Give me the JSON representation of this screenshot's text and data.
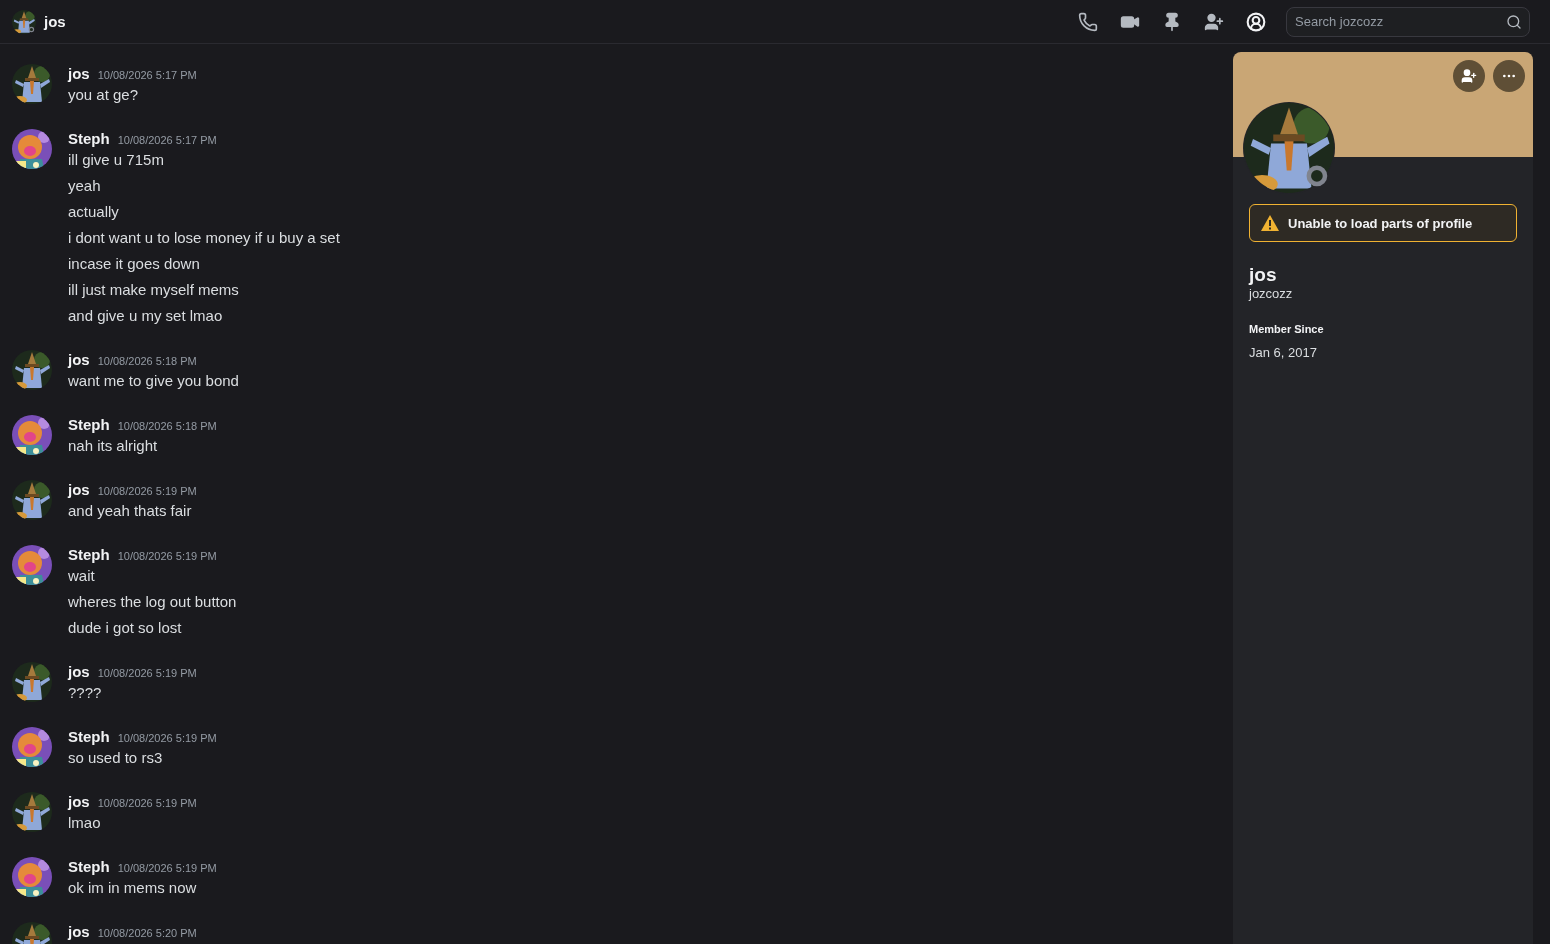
{
  "header": {
    "title": "jos",
    "kind": "wizard",
    "online": false
  },
  "toolbar": [
    {
      "kind": "call",
      "selected": false
    },
    {
      "kind": "video",
      "selected": false
    },
    {
      "kind": "pin",
      "selected": false
    },
    {
      "kind": "add-member",
      "selected": false
    },
    {
      "kind": "profile",
      "selected": true
    }
  ],
  "search": {
    "placeholder": "Search jozcozz"
  },
  "messages": [
    {
      "author": "jos",
      "kind": "wizard",
      "time": "10/08/2026 5:17 PM",
      "lines": [
        "you at ge?"
      ]
    },
    {
      "author": "Steph",
      "kind": "orange",
      "time": "10/08/2026 5:17 PM",
      "lines": [
        "ill give u 715m",
        "yeah",
        "actually",
        "i dont want u to lose money if u buy a set",
        "incase it goes down",
        "ill just make myself mems",
        "and give u my set lmao"
      ]
    },
    {
      "author": "jos",
      "kind": "wizard",
      "time": "10/08/2026 5:18 PM",
      "lines": [
        "want me to give you bond"
      ]
    },
    {
      "author": "Steph",
      "kind": "orange",
      "time": "10/08/2026 5:18 PM",
      "lines": [
        "nah its alright"
      ]
    },
    {
      "author": "jos",
      "kind": "wizard",
      "time": "10/08/2026 5:19 PM",
      "lines": [
        "and yeah thats fair"
      ]
    },
    {
      "author": "Steph",
      "kind": "orange",
      "time": "10/08/2026 5:19 PM",
      "lines": [
        "wait",
        "wheres the log out button",
        "dude i got so lost"
      ]
    },
    {
      "author": "jos",
      "kind": "wizard",
      "time": "10/08/2026 5:19 PM",
      "lines": [
        "????"
      ]
    },
    {
      "author": "Steph",
      "kind": "orange",
      "time": "10/08/2026 5:19 PM",
      "lines": [
        "so used to rs3"
      ]
    },
    {
      "author": "jos",
      "kind": "wizard",
      "time": "10/08/2026 5:19 PM",
      "lines": [
        "lmao"
      ]
    },
    {
      "author": "Steph",
      "kind": "orange",
      "time": "10/08/2026 5:19 PM",
      "lines": [
        "ok im in mems now"
      ]
    },
    {
      "author": "jos",
      "kind": "wizard",
      "time": "10/08/2026 5:20 PM"
    }
  ],
  "profile": {
    "kind": "wizard",
    "online": false,
    "warning": "Unable to load parts of profile",
    "display_name": "jos",
    "username": "jozcozz",
    "member_since_label": "Member Since",
    "member_since": "Jan 6, 2017"
  }
}
